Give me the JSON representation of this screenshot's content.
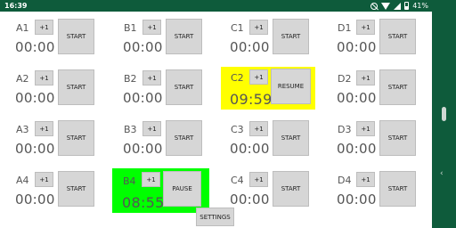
{
  "statusbar": {
    "time": "16:39",
    "battery": "41%"
  },
  "grid": [
    {
      "label": "A1",
      "time": "00:00",
      "plus": "+1",
      "action": "START"
    },
    {
      "label": "B1",
      "time": "00:00",
      "plus": "+1",
      "action": "START"
    },
    {
      "label": "C1",
      "time": "00:00",
      "plus": "+1",
      "action": "START"
    },
    {
      "label": "D1",
      "time": "00:00",
      "plus": "+1",
      "action": "START"
    },
    {
      "label": "A2",
      "time": "00:00",
      "plus": "+1",
      "action": "START"
    },
    {
      "label": "B2",
      "time": "00:00",
      "plus": "+1",
      "action": "START"
    },
    {
      "label": "C2",
      "time": "09:59",
      "plus": "+1",
      "action": "RESUME"
    },
    {
      "label": "D2",
      "time": "00:00",
      "plus": "+1",
      "action": "START"
    },
    {
      "label": "A3",
      "time": "00:00",
      "plus": "+1",
      "action": "START"
    },
    {
      "label": "B3",
      "time": "00:00",
      "plus": "+1",
      "action": "START"
    },
    {
      "label": "C3",
      "time": "00:00",
      "plus": "+1",
      "action": "START"
    },
    {
      "label": "D3",
      "time": "00:00",
      "plus": "+1",
      "action": "START"
    },
    {
      "label": "A4",
      "time": "00:00",
      "plus": "+1",
      "action": "START"
    },
    {
      "label": "B4",
      "time": "08:55",
      "plus": "+1",
      "action": "PAUSE"
    },
    {
      "label": "C4",
      "time": "00:00",
      "plus": "+1",
      "action": "START"
    },
    {
      "label": "D4",
      "time": "00:00",
      "plus": "+1",
      "action": "START"
    }
  ],
  "settings_label": "SETTINGS",
  "colors": {
    "statusbar": "#0e5b3b",
    "paused_highlight": "#ffff00",
    "running_highlight": "#00ff00"
  }
}
